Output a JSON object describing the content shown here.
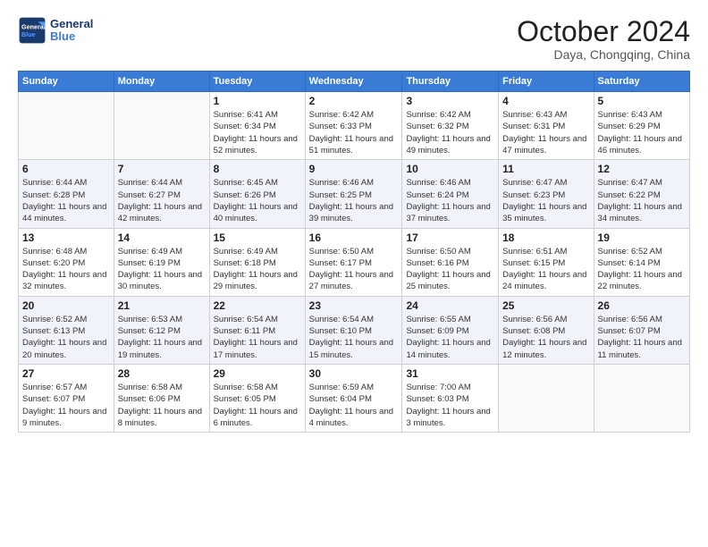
{
  "logo": {
    "text1": "General",
    "text2": "Blue"
  },
  "header": {
    "title": "October 2024",
    "subtitle": "Daya, Chongqing, China"
  },
  "weekdays": [
    "Sunday",
    "Monday",
    "Tuesday",
    "Wednesday",
    "Thursday",
    "Friday",
    "Saturday"
  ],
  "weeks": [
    [
      {
        "day": "",
        "info": ""
      },
      {
        "day": "",
        "info": ""
      },
      {
        "day": "1",
        "info": "Sunrise: 6:41 AM\nSunset: 6:34 PM\nDaylight: 11 hours and 52 minutes."
      },
      {
        "day": "2",
        "info": "Sunrise: 6:42 AM\nSunset: 6:33 PM\nDaylight: 11 hours and 51 minutes."
      },
      {
        "day": "3",
        "info": "Sunrise: 6:42 AM\nSunset: 6:32 PM\nDaylight: 11 hours and 49 minutes."
      },
      {
        "day": "4",
        "info": "Sunrise: 6:43 AM\nSunset: 6:31 PM\nDaylight: 11 hours and 47 minutes."
      },
      {
        "day": "5",
        "info": "Sunrise: 6:43 AM\nSunset: 6:29 PM\nDaylight: 11 hours and 46 minutes."
      }
    ],
    [
      {
        "day": "6",
        "info": "Sunrise: 6:44 AM\nSunset: 6:28 PM\nDaylight: 11 hours and 44 minutes."
      },
      {
        "day": "7",
        "info": "Sunrise: 6:44 AM\nSunset: 6:27 PM\nDaylight: 11 hours and 42 minutes."
      },
      {
        "day": "8",
        "info": "Sunrise: 6:45 AM\nSunset: 6:26 PM\nDaylight: 11 hours and 40 minutes."
      },
      {
        "day": "9",
        "info": "Sunrise: 6:46 AM\nSunset: 6:25 PM\nDaylight: 11 hours and 39 minutes."
      },
      {
        "day": "10",
        "info": "Sunrise: 6:46 AM\nSunset: 6:24 PM\nDaylight: 11 hours and 37 minutes."
      },
      {
        "day": "11",
        "info": "Sunrise: 6:47 AM\nSunset: 6:23 PM\nDaylight: 11 hours and 35 minutes."
      },
      {
        "day": "12",
        "info": "Sunrise: 6:47 AM\nSunset: 6:22 PM\nDaylight: 11 hours and 34 minutes."
      }
    ],
    [
      {
        "day": "13",
        "info": "Sunrise: 6:48 AM\nSunset: 6:20 PM\nDaylight: 11 hours and 32 minutes."
      },
      {
        "day": "14",
        "info": "Sunrise: 6:49 AM\nSunset: 6:19 PM\nDaylight: 11 hours and 30 minutes."
      },
      {
        "day": "15",
        "info": "Sunrise: 6:49 AM\nSunset: 6:18 PM\nDaylight: 11 hours and 29 minutes."
      },
      {
        "day": "16",
        "info": "Sunrise: 6:50 AM\nSunset: 6:17 PM\nDaylight: 11 hours and 27 minutes."
      },
      {
        "day": "17",
        "info": "Sunrise: 6:50 AM\nSunset: 6:16 PM\nDaylight: 11 hours and 25 minutes."
      },
      {
        "day": "18",
        "info": "Sunrise: 6:51 AM\nSunset: 6:15 PM\nDaylight: 11 hours and 24 minutes."
      },
      {
        "day": "19",
        "info": "Sunrise: 6:52 AM\nSunset: 6:14 PM\nDaylight: 11 hours and 22 minutes."
      }
    ],
    [
      {
        "day": "20",
        "info": "Sunrise: 6:52 AM\nSunset: 6:13 PM\nDaylight: 11 hours and 20 minutes."
      },
      {
        "day": "21",
        "info": "Sunrise: 6:53 AM\nSunset: 6:12 PM\nDaylight: 11 hours and 19 minutes."
      },
      {
        "day": "22",
        "info": "Sunrise: 6:54 AM\nSunset: 6:11 PM\nDaylight: 11 hours and 17 minutes."
      },
      {
        "day": "23",
        "info": "Sunrise: 6:54 AM\nSunset: 6:10 PM\nDaylight: 11 hours and 15 minutes."
      },
      {
        "day": "24",
        "info": "Sunrise: 6:55 AM\nSunset: 6:09 PM\nDaylight: 11 hours and 14 minutes."
      },
      {
        "day": "25",
        "info": "Sunrise: 6:56 AM\nSunset: 6:08 PM\nDaylight: 11 hours and 12 minutes."
      },
      {
        "day": "26",
        "info": "Sunrise: 6:56 AM\nSunset: 6:07 PM\nDaylight: 11 hours and 11 minutes."
      }
    ],
    [
      {
        "day": "27",
        "info": "Sunrise: 6:57 AM\nSunset: 6:07 PM\nDaylight: 11 hours and 9 minutes."
      },
      {
        "day": "28",
        "info": "Sunrise: 6:58 AM\nSunset: 6:06 PM\nDaylight: 11 hours and 8 minutes."
      },
      {
        "day": "29",
        "info": "Sunrise: 6:58 AM\nSunset: 6:05 PM\nDaylight: 11 hours and 6 minutes."
      },
      {
        "day": "30",
        "info": "Sunrise: 6:59 AM\nSunset: 6:04 PM\nDaylight: 11 hours and 4 minutes."
      },
      {
        "day": "31",
        "info": "Sunrise: 7:00 AM\nSunset: 6:03 PM\nDaylight: 11 hours and 3 minutes."
      },
      {
        "day": "",
        "info": ""
      },
      {
        "day": "",
        "info": ""
      }
    ]
  ]
}
